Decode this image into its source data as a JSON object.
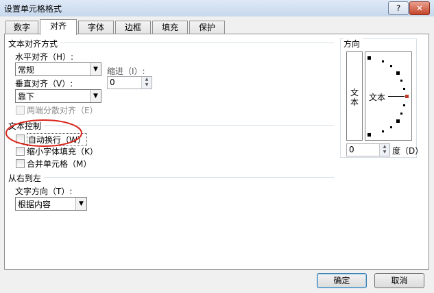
{
  "window": {
    "title": "设置单元格格式",
    "help_label": "?",
    "close_label": "✕"
  },
  "tabs": [
    "数字",
    "对齐",
    "字体",
    "边框",
    "填充",
    "保护"
  ],
  "alignment": {
    "section_title": "文本对齐方式",
    "horizontal_label": "水平对齐（H）:",
    "horizontal_value": "常规",
    "indent_label": "缩进（I）:",
    "indent_value": "0",
    "vertical_label": "垂直对齐（V）:",
    "vertical_value": "靠下",
    "justify_distributed_label": "两端分散对齐（E）"
  },
  "text_control": {
    "section_title": "文本控制",
    "wrap_text_label": "自动换行（W）",
    "shrink_to_fit_label": "缩小字体填充（K）",
    "merge_cells_label": "合并单元格（M）"
  },
  "rtl": {
    "section_title": "从右到左",
    "direction_label": "文字方向（T）:",
    "direction_value": "根据内容"
  },
  "orientation": {
    "section_title": "方向",
    "vertical_text": "文本",
    "horizontal_text": "文本",
    "degree_value": "0",
    "degree_label": "度（D）"
  },
  "buttons": {
    "ok": "确定",
    "cancel": "取消"
  },
  "colors": {
    "highlight_circle": "#d9261c",
    "accent_dot": "#c0392b"
  }
}
